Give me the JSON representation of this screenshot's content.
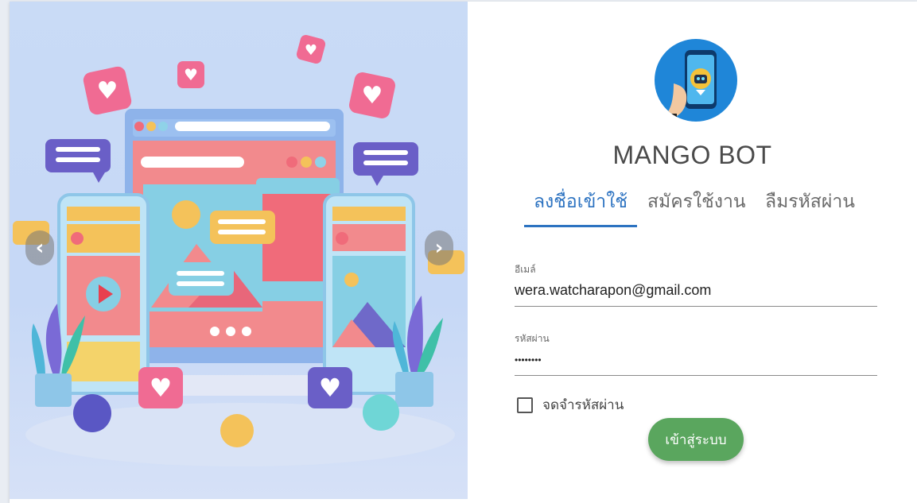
{
  "brand": {
    "name": "MANGO BOT"
  },
  "tabs": [
    {
      "label": "ลงชื่อเข้าใช้"
    },
    {
      "label": "สมัครใช้งาน"
    },
    {
      "label": "ลืมรหัสผ่าน"
    }
  ],
  "form": {
    "email_label": "อีเมล์",
    "email_value": "wera.watcharapon@gmail.com",
    "password_label": "รหัสผ่าน",
    "password_value": "••••••••",
    "remember_label": "จดจำรหัสผ่าน",
    "submit_label": "เข้าสู่ระบบ"
  },
  "carousel": {
    "prev_icon": "chevron-left-icon",
    "next_icon": "chevron-right-icon"
  },
  "colors": {
    "accent": "#2d73c1",
    "button": "#5aa65e",
    "logo_bg": "#1f86d8"
  }
}
